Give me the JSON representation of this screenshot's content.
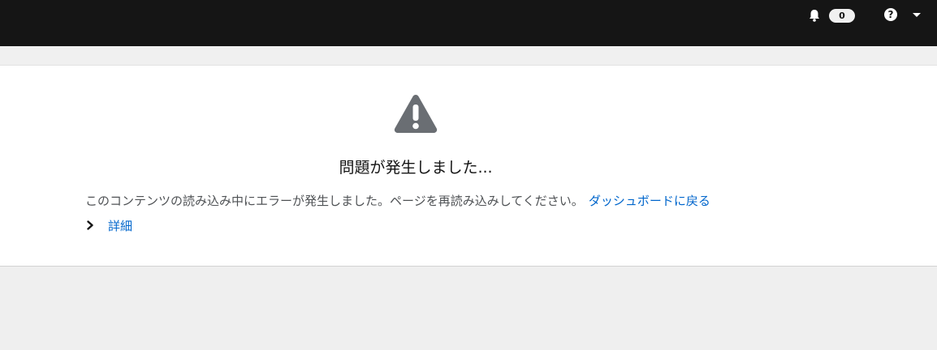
{
  "header": {
    "notification_count": "0",
    "help_icon": "question-circle-icon",
    "notification_icon": "bell-icon",
    "dropdown_icon": "caret-down-icon"
  },
  "error": {
    "icon": "warning-triangle-icon",
    "title": "問題が発生しました...",
    "message": "このコンテンツの読み込み中にエラーが発生しました。ページを再読み込みしてください。",
    "link_label": "ダッシュボードに戻る",
    "details_label": "詳細"
  },
  "colors": {
    "topbar": "#151515",
    "link": "#0066cc",
    "page_bg": "#efefef",
    "icon_gray": "#6a6e73"
  }
}
